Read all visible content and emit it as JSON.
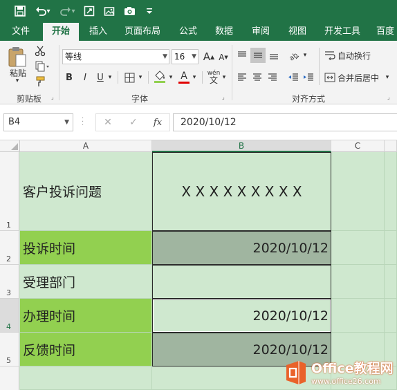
{
  "quick_access": {
    "icons": [
      "save-icon",
      "undo-icon",
      "redo-icon",
      "screenshot-icon",
      "insert-picture-icon",
      "camera-icon",
      "chevron-down-icon"
    ],
    "dropdown_glyph": "▾"
  },
  "ribbon_tabs": [
    {
      "label": "文件",
      "active": false
    },
    {
      "label": "开始",
      "active": true
    },
    {
      "label": "插入",
      "active": false
    },
    {
      "label": "页面布局",
      "active": false
    },
    {
      "label": "公式",
      "active": false
    },
    {
      "label": "数据",
      "active": false
    },
    {
      "label": "审阅",
      "active": false
    },
    {
      "label": "视图",
      "active": false
    },
    {
      "label": "开发工具",
      "active": false
    },
    {
      "label": "百度",
      "active": false
    }
  ],
  "ribbon": {
    "clipboard": {
      "paste_label": "粘贴",
      "group_label": "剪贴板"
    },
    "font": {
      "font_name": "等线",
      "font_size": "16",
      "bold": "B",
      "italic": "I",
      "underline": "U",
      "increase_size": "A",
      "decrease_size": "A",
      "font_color_glyph": "A",
      "phonetic_glyph": "wén",
      "group_label": "字体"
    },
    "alignment": {
      "wrap_text": "自动换行",
      "merge_center": "合并后居中",
      "group_label": "对齐方式"
    }
  },
  "formula_bar": {
    "name_box": "B4",
    "cancel_glyph": "✕",
    "enter_glyph": "✓",
    "fx_glyph": "fx",
    "value": "2020/10/12"
  },
  "sheet": {
    "columns": [
      "A",
      "B",
      "C"
    ],
    "selected_column": "B",
    "rows": [
      {
        "num": "1",
        "a": "客户投诉问题",
        "b": "X X X X X X X X X"
      },
      {
        "num": "2",
        "a": "投诉时间",
        "b": "2020/10/12"
      },
      {
        "num": "3",
        "a": "受理部门",
        "b": ""
      },
      {
        "num": "4",
        "a": "办理时间",
        "b": "2020/10/12"
      },
      {
        "num": "5",
        "a": "反馈时间",
        "b": "2020/10/12"
      }
    ],
    "selected_row": "4"
  },
  "watermark": {
    "title": "Office教程网",
    "url": "www.office26.com"
  },
  "colors": {
    "title_green": "#217346",
    "label_fill": "#92d050",
    "date_fill": "#a0b5a0",
    "sheet_tint": "#cfe8cf",
    "watermark_orange": "#e9622a"
  }
}
